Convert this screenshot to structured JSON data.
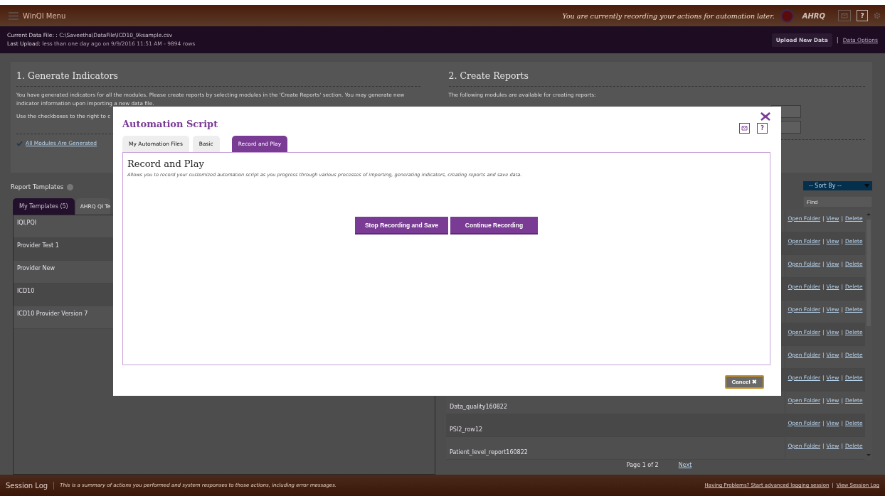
{
  "header": {
    "menu_label": "WinQI Menu",
    "recording_notice": "You are currently recording your actions for automation later.",
    "logo": "AHRQ",
    "help": "?"
  },
  "data_bar": {
    "file_label": "Current Data File: :",
    "file_path": "C:\\Saveetha\\DataFile\\ICD10_9ksample.csv",
    "upload_label": "Last Upload:",
    "upload_info": "less than one day ago on 9/9/2016 11:51 AM - 9894 rows",
    "upload_button": "Upload New Data",
    "separator": "|",
    "options_link": "Data Options"
  },
  "generate_panel": {
    "title": "1. Generate Indicators",
    "paragraphs": [
      "You have generated indicators for all the modules. Please create reports by selecting modules in the 'Create Reports' section. You may generate new indicator information upon importing a new data file.",
      "Use the checkboxes to the right to c"
    ],
    "status_link": "All Modules Are Generated"
  },
  "reports_panel": {
    "title": "2. Create Reports",
    "text": "The following modules are available for creating reports:"
  },
  "templates": {
    "title": "Report Templates",
    "tabs": [
      {
        "label": "My Templates (5)",
        "selected": true
      },
      {
        "label": "AHRQ QI Te",
        "selected": false
      }
    ],
    "rows": [
      "IQI,PQI",
      "Provider Test 1",
      "Provider New",
      "ICD10",
      "ICD10 Provider Version 7"
    ]
  },
  "report_list": {
    "sort": "-- Sort By --",
    "find_placeholder": "Find",
    "action_separator": "|",
    "rows": [
      {
        "actions": [
          "Open Folder",
          "View",
          "Delete"
        ]
      },
      {
        "actions": [
          "Open Folder",
          "View",
          "Delete"
        ]
      },
      {
        "actions": [
          "Open Folder",
          "View",
          "Delete"
        ]
      },
      {
        "actions": [
          "Open Folder",
          "View",
          "Delete"
        ]
      },
      {
        "actions": [
          "Open Folder",
          "View",
          "Delete"
        ]
      },
      {
        "actions": [
          "Open Folder",
          "View",
          "Delete"
        ]
      },
      {
        "actions": [
          "Open Folder",
          "View",
          "Delete"
        ]
      },
      {
        "actions": [
          "Open Folder",
          "View",
          "Delete"
        ]
      },
      {
        "name": "Data_quality160822",
        "actions": [
          "Open Folder",
          "View",
          "Delete"
        ]
      },
      {
        "name": "PSI2_row12",
        "actions": [
          "Open Folder",
          "View",
          "Delete"
        ]
      },
      {
        "name": "Patient_level_report160822",
        "actions": [
          "Open Folder",
          "View",
          "Delete"
        ]
      }
    ],
    "pager": "Page 1 of 2",
    "next": "Next"
  },
  "footer": {
    "title": "Session Log",
    "summary": "This is a summary of actions you performed and system responses to those actions, including error messages.",
    "links": [
      "Having Problems? Start advanced logging session",
      "View Session Log"
    ],
    "separator": "|"
  },
  "modal": {
    "title": "Automation Script",
    "help": "?",
    "tabs": [
      {
        "label": "My Automation Files",
        "selected": false
      },
      {
        "label": "Basic",
        "selected": false
      },
      {
        "label": "Record and Play",
        "selected": true
      }
    ],
    "heading": "Record and Play",
    "description": "Allows you to record your customized automation script as you progress through various processes of importing, generating indicators, creating reports and save data.",
    "buttons": [
      "Stop Recording and Save",
      "Continue Recording"
    ],
    "cancel": "Cancel",
    "cancel_icon": "✖"
  }
}
